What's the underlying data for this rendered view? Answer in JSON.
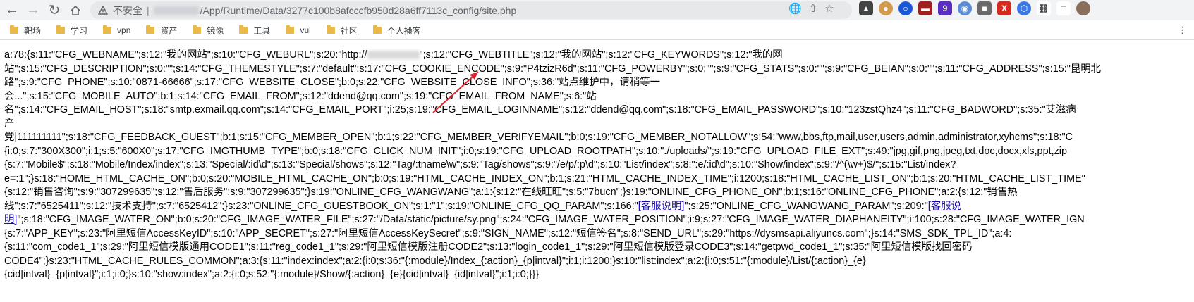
{
  "toolbar": {
    "back_icon": "arrow-left-icon",
    "forward_icon": "arrow-right-icon",
    "reload_icon": "reload-icon",
    "home_icon": "home-icon",
    "insecure_label": "不安全",
    "url_path": "/App/Runtime/Data/3277c100b8afcccfb950d28a6ff7113c_config/site.php"
  },
  "bookmarks": [
    "靶场",
    "学习",
    "vpn",
    "资产",
    "镜像",
    "工具",
    "vul",
    "社区",
    "个人播客"
  ],
  "content": {
    "line1a": "a:78:{s:11:\"CFG_WEBNAME\";s:12:\"我的网站\";s:10:\"CFG_WEBURL\";s:20:\"http://",
    "line1b": "\";s:12:\"CFG_WEBTITLE\";s:12:\"我的网站\";s:12:\"CFG_KEYWORDS\";s:12:\"我的网",
    "line2": "站\";s:15:\"CFG_DESCRIPTION\";s:0:\"\";s:14:\"CFG_THEMESTYLE\";s:7:\"default\";s:17:\"CFG_COOKIE_ENCODE\";s:9:\"P4tzizR6d\";s:11:\"CFG_POWERBY\";s:0:\"\";s:9:\"CFG_STATS\";s:0:\"\";s:9:\"CFG_BEIAN\";s:0:\"\";s:11:\"CFG_ADDRESS\";s:15:\"昆明北",
    "line3": "路\";s:9:\"CFG_PHONE\";s:10:\"0871-66666\";s:17:\"CFG_WEBSITE_CLOSE\";b:0;s:22:\"CFG_WEBSITE_CLOSE_INFO\";s:36:\"站点维护中，请稍等一",
    "line4": "会...\";s:15:\"CFG_MOBILE_AUTO\";b:1;s:14:\"CFG_EMAIL_FROM\";s:12:\"ddend@qq.com\";s:19:\"CFG_EMAIL_FROM_NAME\";s:6:\"站",
    "line5": "名\";s:14:\"CFG_EMAIL_HOST\";s:18:\"smtp.exmail.qq.com\";s:14:\"CFG_EMAIL_PORT\";i:25;s:19:\"CFG_EMAIL_LOGINNAME\";s:12:\"ddend@qq.com\";s:18:\"CFG_EMAIL_PASSWORD\";s:10:\"123zstQhz4\";s:11:\"CFG_BADWORD\";s:35:\"艾滋病",
    "line6": "产",
    "line7": "党|111111111\";s:18:\"CFG_FEEDBACK_GUEST\";b:1;s:15:\"CFG_MEMBER_OPEN\";b:1;s:22:\"CFG_MEMBER_VERIFYEMAIL\";b:0;s:19:\"CFG_MEMBER_NOTALLOW\";s:54:\"www,bbs,ftp,mail,user,users,admin,administrator,xyhcms\";s:18:\"C",
    "line8": "{i:0;s:7:\"300X300\";i:1;s:5:\"600X0\";s:17:\"CFG_IMGTHUMB_TYPE\";b:0;s:18:\"CFG_CLICK_NUM_INIT\";i:0;s:19:\"CFG_UPLOAD_ROOTPATH\";s:10:\"./uploads/\";s:19:\"CFG_UPLOAD_FILE_EXT\";s:49:\"jpg,gif,png,jpeg,txt,doc,docx,xls,ppt,zip",
    "line9": "{s:7:\"Mobile$\";s:18:\"Mobile/Index/index\";s:13:\"Special/:id\\d\";s:13:\"Special/shows\";s:12:\"Tag/:tname\\w\";s:9:\"Tag/shows\";s:9:\"/e/p/:p\\d\";s:10:\"List/index\";s:8:\":e/:id\\d\";s:10:\"Show/index\";s:9:\"/^(\\w+)$/\";s:15:\"List/index?",
    "line10": "e=:1\";}s:18:\"HOME_HTML_CACHE_ON\";b:0;s:20:\"MOBILE_HTML_CACHE_ON\";b:0;s:19:\"HTML_CACHE_INDEX_ON\";b:1;s:21:\"HTML_CACHE_INDEX_TIME\";i:1200;s:18:\"HTML_CACHE_LIST_ON\";b:1;s:20:\"HTML_CACHE_LIST_TIME\"",
    "line11": "{s:12:\"销售咨询\";s:9:\"307299635\";s:12:\"售后服务\";s:9:\"307299635\";}s:19:\"ONLINE_CFG_WANGWANG\";a:1:{s:12:\"在线旺旺\";s:5:\"7bucn\";}s:19:\"ONLINE_CFG_PHONE_ON\";b:1;s:16:\"ONLINE_CFG_PHONE\";a:2:{s:12:\"销售热",
    "line12a": "线\";s:7:\"6525411\";s:12:\"技术支持\";s:7:\"6525412\";}s:23:\"ONLINE_CFG_GUESTBOOK_ON\";s:1:\"1\";s:19:\"ONLINE_CFG_QQ_PARAM\";s:166:\"",
    "link1": "[客服说明]",
    "line12b": "\";s:25:\"ONLINE_CFG_WANGWANG_PARAM\";s:209:\"",
    "link2a": "[客服说",
    "link2b": "明]",
    "line13b": "\";s:18:\"CFG_IMAGE_WATER_ON\";b:0;s:20:\"CFG_IMAGE_WATER_FILE\";s:27:\"/Data/static/picture/sy.png\";s:24:\"CFG_IMAGE_WATER_POSITION\";i:9;s:27:\"CFG_IMAGE_WATER_DIAPHANEITY\";i:100;s:28:\"CFG_IMAGE_WATER_IGN",
    "line14": "{s:7:\"APP_KEY\";s:23:\"阿里短信AccessKeyID\";s:10:\"APP_SECRET\";s:27:\"阿里短信AccessKeySecret\";s:9:\"SIGN_NAME\";s:12:\"短信签名\";s:8:\"SEND_URL\";s:29:\"https://dysmsapi.aliyuncs.com\";}s:14:\"SMS_SDK_TPL_ID\";a:4:",
    "line15": "{s:11:\"com_code1_1\";s:29:\"阿里短信模版通用CODE1\";s:11:\"reg_code1_1\";s:29:\"阿里短信模版注册CODE2\";s:13:\"login_code1_1\";s:29:\"阿里短信模版登录CODE3\";s:14:\"getpwd_code1_1\";s:35:\"阿里短信模版找回密码",
    "line16": "CODE4\";}s:23:\"HTML_CACHE_RULES_COMMON\";a:3:{s:11:\"index:index\";a:2:{i:0;s:36:\"{:module}/Index_{:action}_{p|intval}\";i:1;i:1200;}s:10:\"list:index\";a:2:{i:0;s:51:\"{:module}/List/{:action}_{e}",
    "line17": "{cid|intval}_{p|intval}\";i:1;i:0;}s:10:\"show:index\";a:2:{i:0;s:52:\"{:module}/Show/{:action}_{e}{cid|intval}_{id|intval}\";i:1;i:0;}}}"
  }
}
